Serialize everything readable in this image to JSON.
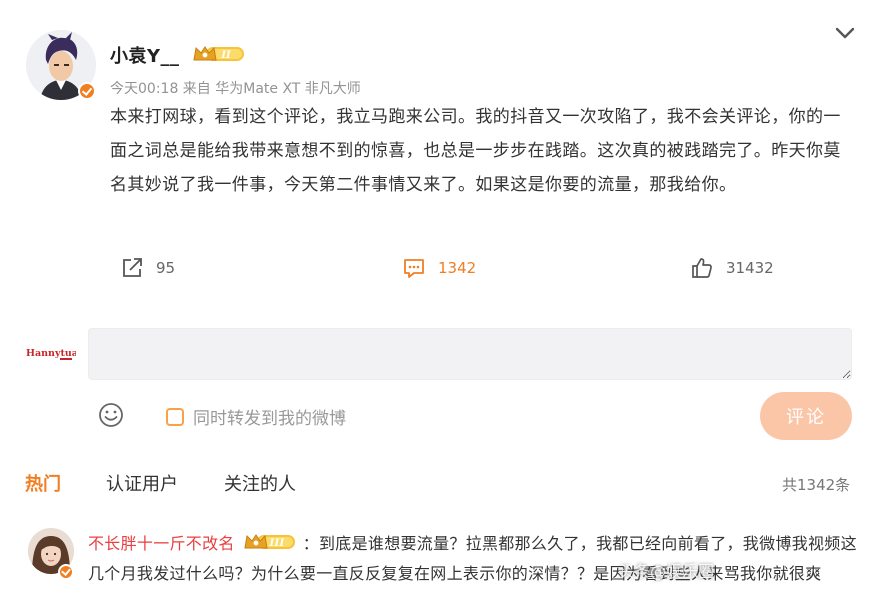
{
  "post": {
    "username": "小袁Y__",
    "vip_level": "II",
    "meta": "今天00:18 来自 华为Mate XT 非凡大师",
    "body": "本来打网球，看到这个评论，我立马跑来公司。我的抖音又一次攻陷了，我不会关评论，你的一面之词总是能给我带来意想不到的惊喜，也总是一步步在践踏。这次真的被践踏完了。昨天你莫名其妙说了我一件事，今天第二件事情又来了。如果这是你要的流量，那我给你。"
  },
  "actions": {
    "repost_count": "95",
    "comment_count": "1342",
    "like_count": "31432"
  },
  "composer": {
    "user_logo_text": "Hannytuan",
    "input_value": "",
    "forward_label": "同时转发到我的微博",
    "submit_label": "评论"
  },
  "tabs": {
    "items": [
      "热门",
      "认证用户",
      "关注的人"
    ],
    "total": "共1342条"
  },
  "comments": [
    {
      "name": "不长胖十一斤不改名",
      "vip_level": "III",
      "text": "：到底是谁想要流量？拉黑都那么久了，我都已经向前看了，我微博我视频这几个月我发过什么吗？为什么要一直反反复复在网上表示你的深情？？是因为看到些人来骂我你就很爽"
    }
  ],
  "watermark": "头条@娱乐圈",
  "colors": {
    "accent": "#f07e22",
    "comment_name": "#e94040",
    "submit_disabled": "#fbc6a8",
    "input_bg": "#f2f2f5"
  },
  "icons": {
    "collapse": "chevron-down-icon",
    "repost": "share-icon",
    "comment": "comment-icon",
    "like": "thumb-up-icon",
    "emoji": "smiley-icon",
    "verified": "verified-v-icon",
    "vip": "crown-badge-icon"
  }
}
